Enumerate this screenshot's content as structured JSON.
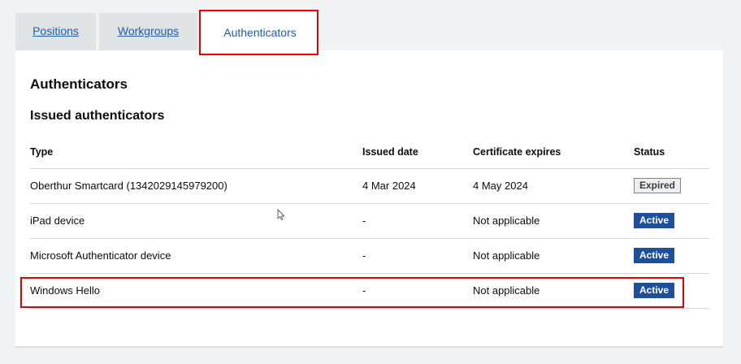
{
  "tabs": [
    {
      "label": "Positions",
      "active": false
    },
    {
      "label": "Workgroups",
      "active": false
    },
    {
      "label": "Authenticators",
      "active": true
    }
  ],
  "page": {
    "title": "Authenticators",
    "section_title": "Issued authenticators"
  },
  "table": {
    "headers": {
      "type": "Type",
      "issued": "Issued date",
      "expires": "Certificate expires",
      "status": "Status"
    },
    "rows": [
      {
        "type": "Oberthur Smartcard (1342029145979200)",
        "issued": "4 Mar 2024",
        "expires": "4 May 2024",
        "status": "Expired"
      },
      {
        "type": "iPad device",
        "issued": "-",
        "expires": "Not applicable",
        "status": "Active"
      },
      {
        "type": "Microsoft Authenticator device",
        "issued": "-",
        "expires": "Not applicable",
        "status": "Active"
      },
      {
        "type": "Windows Hello",
        "issued": "-",
        "expires": "Not applicable",
        "status": "Active"
      }
    ]
  },
  "colors": {
    "link": "#1d5da8",
    "active_badge": "#1d4f9a",
    "highlight": "#e00000"
  }
}
